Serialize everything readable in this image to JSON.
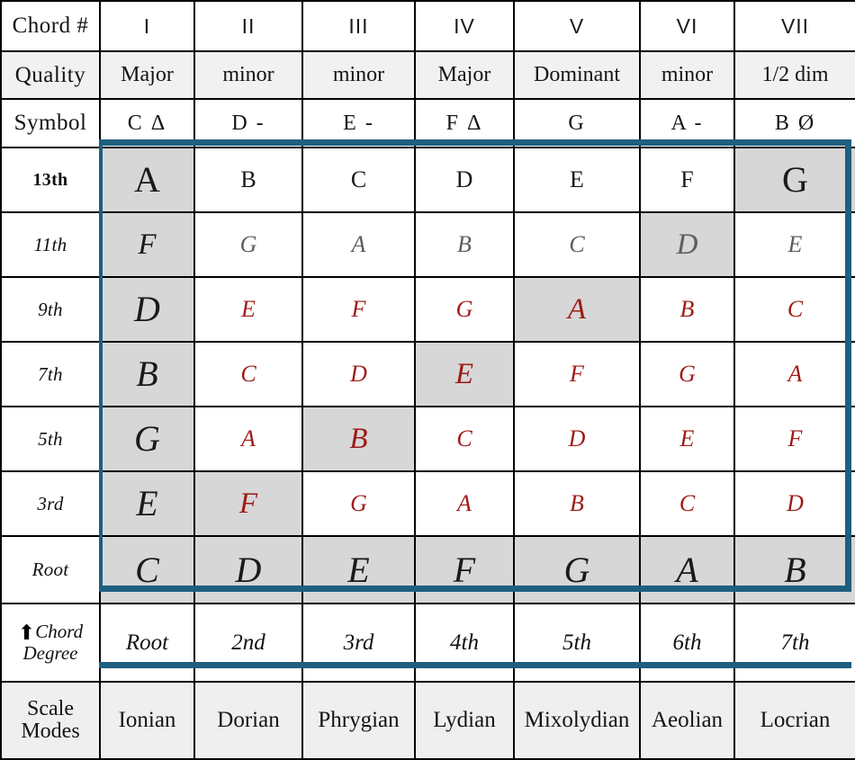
{
  "title": "Chord Scale / Modes Reference Table",
  "colors": {
    "accent_blue": "#1e5f80",
    "highlight_gray": "#d7d7d7",
    "quality_row_gray": "#f1f1f1",
    "modes_row_gray": "#efefef",
    "red_ink": "#9e1b17",
    "gray_ink": "#5e5e5e",
    "dark_ink": "#1a1a1a",
    "grid_black": "#000000"
  },
  "row_labels": {
    "chord_number": "Chord #",
    "quality": "Quality",
    "symbol": "Symbol",
    "thirteenth": "13th",
    "eleventh": "11th",
    "ninth": "9th",
    "seventh": "7th",
    "fifth": "5th",
    "third": "3rd",
    "root": "Root",
    "chord_degree_line1": "Chord",
    "chord_degree_line2": "Degree",
    "chord_degree_arrow": "up-arrow-icon",
    "chord_degree_arrow_glyph": "⬆",
    "scale_modes_line1": "Scale",
    "scale_modes_line2": "Modes"
  },
  "chart_data": {
    "type": "table",
    "title": "Chord # / Quality / Symbol / Chord tones by scale degree",
    "columns": [
      "I",
      "II",
      "III",
      "IV",
      "V",
      "VI",
      "VII"
    ],
    "rows": [
      {
        "label": "Chord #",
        "values": [
          "I",
          "II",
          "III",
          "IV",
          "V",
          "VI",
          "VII"
        ]
      },
      {
        "label": "Quality",
        "values": [
          "Major",
          "minor",
          "minor",
          "Major",
          "Dominant",
          "minor",
          "1/2 dim"
        ]
      },
      {
        "label": "Symbol",
        "values": [
          "C Δ",
          "D -",
          "E -",
          "F Δ",
          "G",
          "A -",
          "B Ø"
        ]
      },
      {
        "label": "13th",
        "values": [
          "A",
          "B",
          "C",
          "D",
          "E",
          "F",
          "G"
        ],
        "ink": [
          "dark",
          "dark",
          "dark",
          "dark",
          "dark",
          "dark",
          "dark"
        ],
        "highlight": [
          true,
          false,
          false,
          false,
          false,
          false,
          true
        ]
      },
      {
        "label": "11th",
        "values": [
          "F",
          "G",
          "A",
          "B",
          "C",
          "D",
          "E"
        ],
        "ink": [
          "dark",
          "gray",
          "gray",
          "gray",
          "gray",
          "gray",
          "gray"
        ],
        "highlight": [
          true,
          false,
          false,
          false,
          false,
          true,
          false
        ]
      },
      {
        "label": "9th",
        "values": [
          "D",
          "E",
          "F",
          "G",
          "A",
          "B",
          "C"
        ],
        "ink": [
          "dark",
          "red",
          "red",
          "red",
          "red",
          "red",
          "red"
        ],
        "highlight": [
          true,
          false,
          false,
          false,
          true,
          false,
          false
        ]
      },
      {
        "label": "7th",
        "values": [
          "B",
          "C",
          "D",
          "E",
          "F",
          "G",
          "A"
        ],
        "ink": [
          "dark",
          "red",
          "red",
          "red",
          "red",
          "red",
          "red"
        ],
        "highlight": [
          true,
          false,
          false,
          true,
          false,
          false,
          false
        ]
      },
      {
        "label": "5th",
        "values": [
          "G",
          "A",
          "B",
          "C",
          "D",
          "E",
          "F"
        ],
        "ink": [
          "dark",
          "red",
          "red",
          "red",
          "red",
          "red",
          "red"
        ],
        "highlight": [
          true,
          false,
          true,
          false,
          false,
          false,
          false
        ]
      },
      {
        "label": "3rd",
        "values": [
          "E",
          "F",
          "G",
          "A",
          "B",
          "C",
          "D"
        ],
        "ink": [
          "dark",
          "red",
          "red",
          "red",
          "red",
          "red",
          "red"
        ],
        "highlight": [
          true,
          true,
          false,
          false,
          false,
          false,
          false
        ]
      },
      {
        "label": "Root",
        "values": [
          "C",
          "D",
          "E",
          "F",
          "G",
          "A",
          "B"
        ],
        "ink": [
          "dark",
          "dark",
          "dark",
          "dark",
          "dark",
          "dark",
          "dark"
        ],
        "highlight": [
          true,
          true,
          true,
          true,
          true,
          true,
          true
        ]
      },
      {
        "label": "Chord Degree",
        "values": [
          "Root",
          "2nd",
          "3rd",
          "4th",
          "5th",
          "6th",
          "7th"
        ]
      },
      {
        "label": "Scale Modes",
        "values": [
          "Ionian",
          "Dorian",
          "Phrygian",
          "Lydian",
          "Mixolydian",
          "Aeolian",
          "Locrian"
        ]
      }
    ]
  }
}
